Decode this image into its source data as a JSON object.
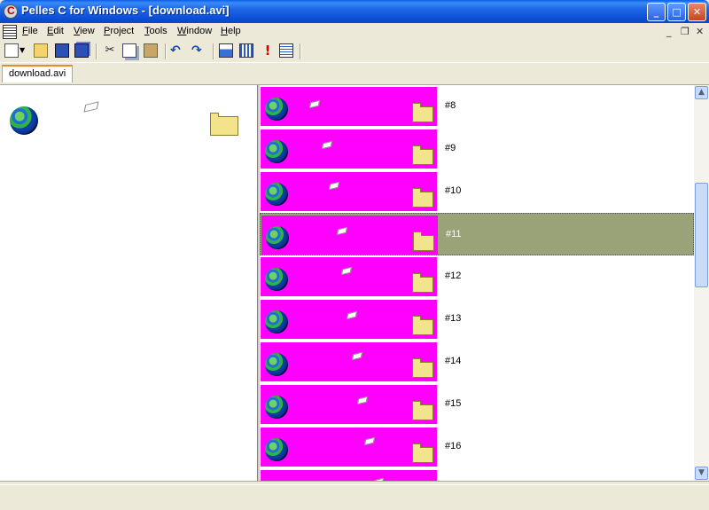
{
  "window": {
    "title": "Pelles C for Windows - [download.avi]"
  },
  "title_buttons": {
    "minimize": "_",
    "maximize": "□",
    "close": "✕"
  },
  "menu": {
    "items": [
      {
        "pre": "",
        "u": "F",
        "post": "ile"
      },
      {
        "pre": "",
        "u": "E",
        "post": "dit"
      },
      {
        "pre": "",
        "u": "V",
        "post": "iew"
      },
      {
        "pre": "",
        "u": "P",
        "post": "roject"
      },
      {
        "pre": "",
        "u": "T",
        "post": "ools"
      },
      {
        "pre": "",
        "u": "W",
        "post": "indow"
      },
      {
        "pre": "",
        "u": "H",
        "post": "elp"
      }
    ],
    "mdi_minimize": "_",
    "mdi_restore": "❐",
    "mdi_close": "✕"
  },
  "toolbar": {
    "icons": [
      "new-icon",
      "dropdown-arrow-icon",
      "open-icon",
      "save-icon",
      "save-all-icon",
      "cut-icon",
      "copy-icon",
      "paste-icon",
      "undo-icon",
      "redo-icon",
      "compile-icon",
      "build-icon",
      "execute-icon",
      "properties-icon"
    ]
  },
  "tabs": [
    {
      "label": "download.avi"
    }
  ],
  "frames": [
    {
      "label": "#8",
      "selected": false
    },
    {
      "label": "#9",
      "selected": false
    },
    {
      "label": "#10",
      "selected": false
    },
    {
      "label": "#11",
      "selected": true
    },
    {
      "label": "#12",
      "selected": false
    },
    {
      "label": "#13",
      "selected": false
    },
    {
      "label": "#14",
      "selected": false
    },
    {
      "label": "#15",
      "selected": false
    },
    {
      "label": "#16",
      "selected": false
    },
    {
      "label": "",
      "selected": false
    }
  ],
  "colors": {
    "frame_background": "#ff00ff",
    "selection": "#9aa277",
    "title_bar": "#0a5ee8"
  },
  "scrollbar": {
    "up": "▲",
    "down": "▼"
  }
}
